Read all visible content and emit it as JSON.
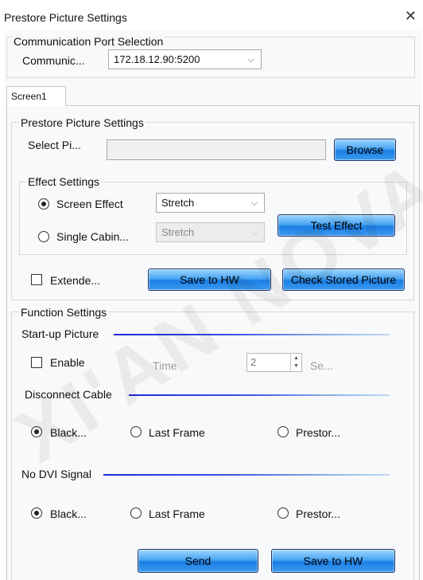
{
  "window": {
    "title": "Prestore Picture Settings",
    "close_icon": "close-icon"
  },
  "comm": {
    "group_title": "Communication Port Selection",
    "label": "Communic...",
    "value": "172.18.12.90:5200"
  },
  "tabs": [
    {
      "label": "Screen1"
    }
  ],
  "prestore": {
    "group_title": "Prestore Picture Settings",
    "select_label": "Select Pi...",
    "select_value": "",
    "browse_label": "Browse",
    "effect": {
      "group_title": "Effect Settings",
      "screen_effect_label": "Screen Effect",
      "screen_effect_value": "Stretch",
      "single_cabinet_label": "Single Cabin...",
      "single_cabinet_value": "Stretch",
      "test_effect_label": "Test Effect",
      "selected": "screen_effect"
    },
    "extended_label": "Extende...",
    "save_hw_label": "Save to HW",
    "check_stored_label": "Check Stored Picture"
  },
  "function": {
    "group_title": "Function Settings",
    "startup": {
      "heading": "Start-up Picture",
      "enable_label": "Enable",
      "time_label": "Time",
      "time_value": "2",
      "seconds_label": "Se..."
    },
    "disconnect": {
      "heading": "Disconnect Cable",
      "options": [
        "Black...",
        "Last Frame",
        "Prestor..."
      ],
      "selected": "Black..."
    },
    "no_dvi": {
      "heading": "No DVI Signal",
      "options": [
        "Black...",
        "Last Frame",
        "Prestor..."
      ],
      "selected": "Black..."
    }
  },
  "footer": {
    "send_label": "Send",
    "save_hw_label": "Save to HW"
  },
  "watermark": "XI'AN NOVASTAR"
}
